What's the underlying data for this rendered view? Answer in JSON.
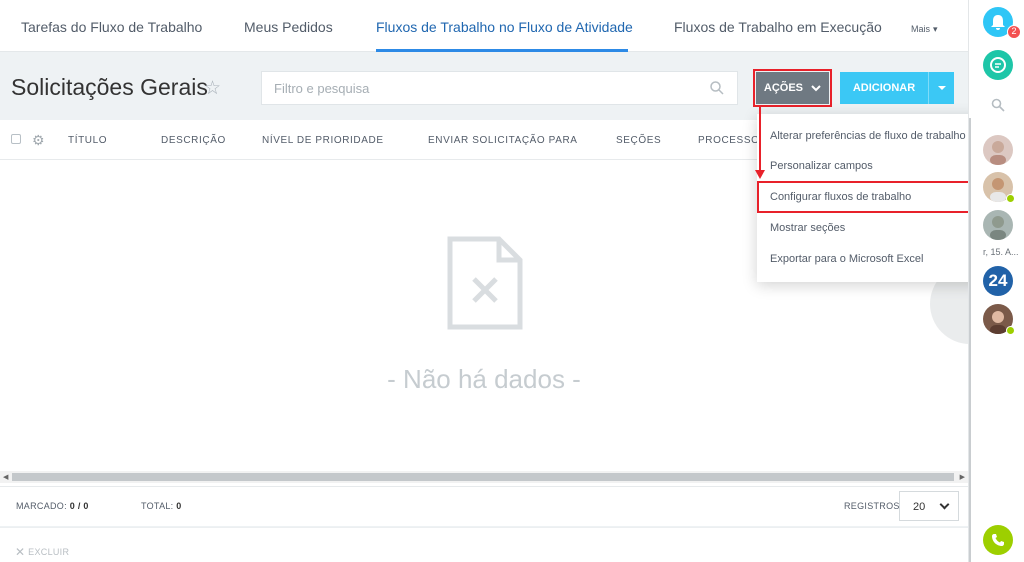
{
  "topnav": {
    "tabs": [
      {
        "label": "Tarefas do Fluxo de Trabalho"
      },
      {
        "label": "Meus Pedidos"
      },
      {
        "label": "Fluxos de Trabalho no Fluxo de Atividade"
      },
      {
        "label": "Fluxos de Trabalho em Execução"
      }
    ],
    "more_label": "Mais",
    "active_tab_index": 2
  },
  "header": {
    "title": "Solicitações Gerais",
    "search_placeholder": "Filtro e pesquisa",
    "actions_label": "AÇÕES",
    "add_label": "ADICIONAR"
  },
  "grid": {
    "columns": [
      "TÍTULO",
      "DESCRIÇÃO",
      "NÍVEL DE PRIORIDADE",
      "ENVIAR SOLICITAÇÃO PARA",
      "SEÇÕES",
      "PROCESSOS"
    ],
    "empty_text": "- Não há dados -"
  },
  "footer": {
    "marked_label": "MARCADO:",
    "marked_value": "0 / 0",
    "total_label": "TOTAL:",
    "total_value": "0",
    "records_label": "REGISTROS:",
    "records_value": "20",
    "delete_label": "EXCLUIR"
  },
  "actions_menu": {
    "items": [
      {
        "label": "Alterar preferências de fluxo de trabalho"
      },
      {
        "label": "Personalizar campos"
      },
      {
        "label": "Configurar fluxos de trabalho"
      },
      {
        "label": "Mostrar seções"
      },
      {
        "label": "Exportar para o Microsoft Excel"
      }
    ],
    "highlighted_index": 2
  },
  "sidebar": {
    "notification_count": "2",
    "user_label": "r, 15. A...",
    "b24_label": "24"
  },
  "colors": {
    "accent_blue": "#2d8ae6",
    "add_button": "#3bc8f5",
    "actions_button": "#6f7982",
    "highlight_red": "#e8212a",
    "online_green": "#9dcf00"
  }
}
